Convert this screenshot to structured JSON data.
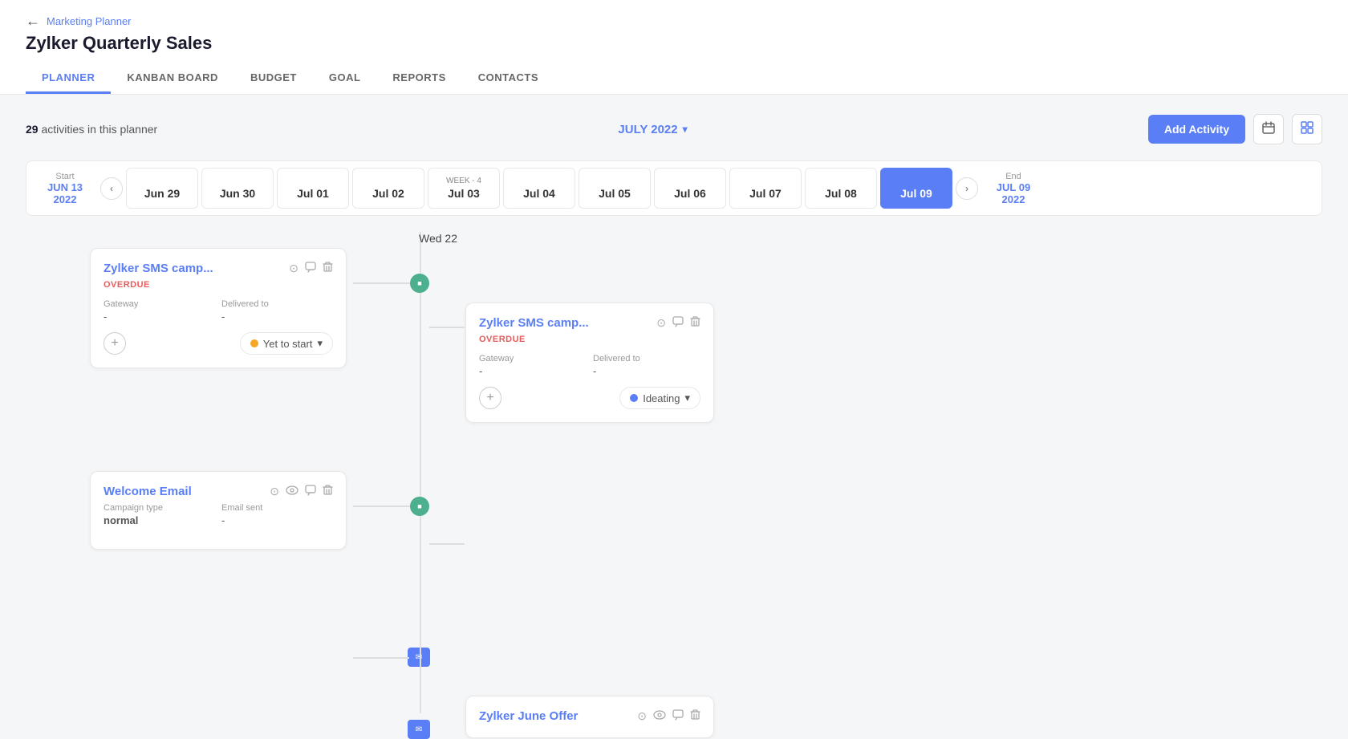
{
  "header": {
    "breadcrumb": "Marketing Planner",
    "title": "Zylker Quarterly Sales",
    "back_arrow": "←"
  },
  "tabs": [
    {
      "label": "PLANNER",
      "active": true
    },
    {
      "label": "KANBAN BOARD",
      "active": false
    },
    {
      "label": "BUDGET",
      "active": false
    },
    {
      "label": "GOAL",
      "active": false
    },
    {
      "label": "REPORTS",
      "active": false
    },
    {
      "label": "CONTACTS",
      "active": false
    }
  ],
  "toolbar": {
    "activity_count_num": "29",
    "activity_count_label": " activities in this planner",
    "month_label": "JULY 2022",
    "add_activity_label": "Add Activity",
    "calendar_icon": "📅",
    "grid_icon": "⊞"
  },
  "calendar": {
    "start_label": "Start",
    "start_date": "JUN 13",
    "start_year": "2022",
    "end_label": "End",
    "end_date": "JUL 09",
    "end_year": "2022",
    "days": [
      {
        "label": "",
        "date": "Jun 29",
        "active": false
      },
      {
        "label": "",
        "date": "Jun 30",
        "active": false
      },
      {
        "label": "",
        "date": "Jul 01",
        "active": false
      },
      {
        "label": "",
        "date": "Jul 02",
        "active": false
      },
      {
        "label": "WEEK - 4",
        "date": "Jul 03",
        "active": false
      },
      {
        "label": "",
        "date": "Jul 04",
        "active": false
      },
      {
        "label": "",
        "date": "Jul 05",
        "active": false
      },
      {
        "label": "",
        "date": "Jul 06",
        "active": false
      },
      {
        "label": "",
        "date": "Jul 07",
        "active": false
      },
      {
        "label": "",
        "date": "Jul 08",
        "active": false
      },
      {
        "label": "",
        "date": "Jul 09",
        "active": true
      }
    ]
  },
  "timeline": {
    "wed_label": "Wed 22"
  },
  "cards": {
    "card1": {
      "title": "Zylker SMS camp...",
      "status": "OVERDUE",
      "field1_label": "Gateway",
      "field1_value": "-",
      "field2_label": "Delivered to",
      "field2_value": "-",
      "badge_label": "Yet to start",
      "badge_chevron": "▾"
    },
    "card2": {
      "title": "Zylker SMS camp...",
      "status": "OVERDUE",
      "field1_label": "Gateway",
      "field1_value": "-",
      "field2_label": "Delivered to",
      "field2_value": "-",
      "badge_label": "Ideating",
      "badge_chevron": "▾"
    },
    "card3": {
      "title": "Welcome Email",
      "status": "",
      "field1_label": "Campaign type",
      "field1_value": "normal",
      "field2_label": "Email sent",
      "field2_value": "-"
    },
    "card4": {
      "title": "Zylker June Offer",
      "status": ""
    }
  }
}
